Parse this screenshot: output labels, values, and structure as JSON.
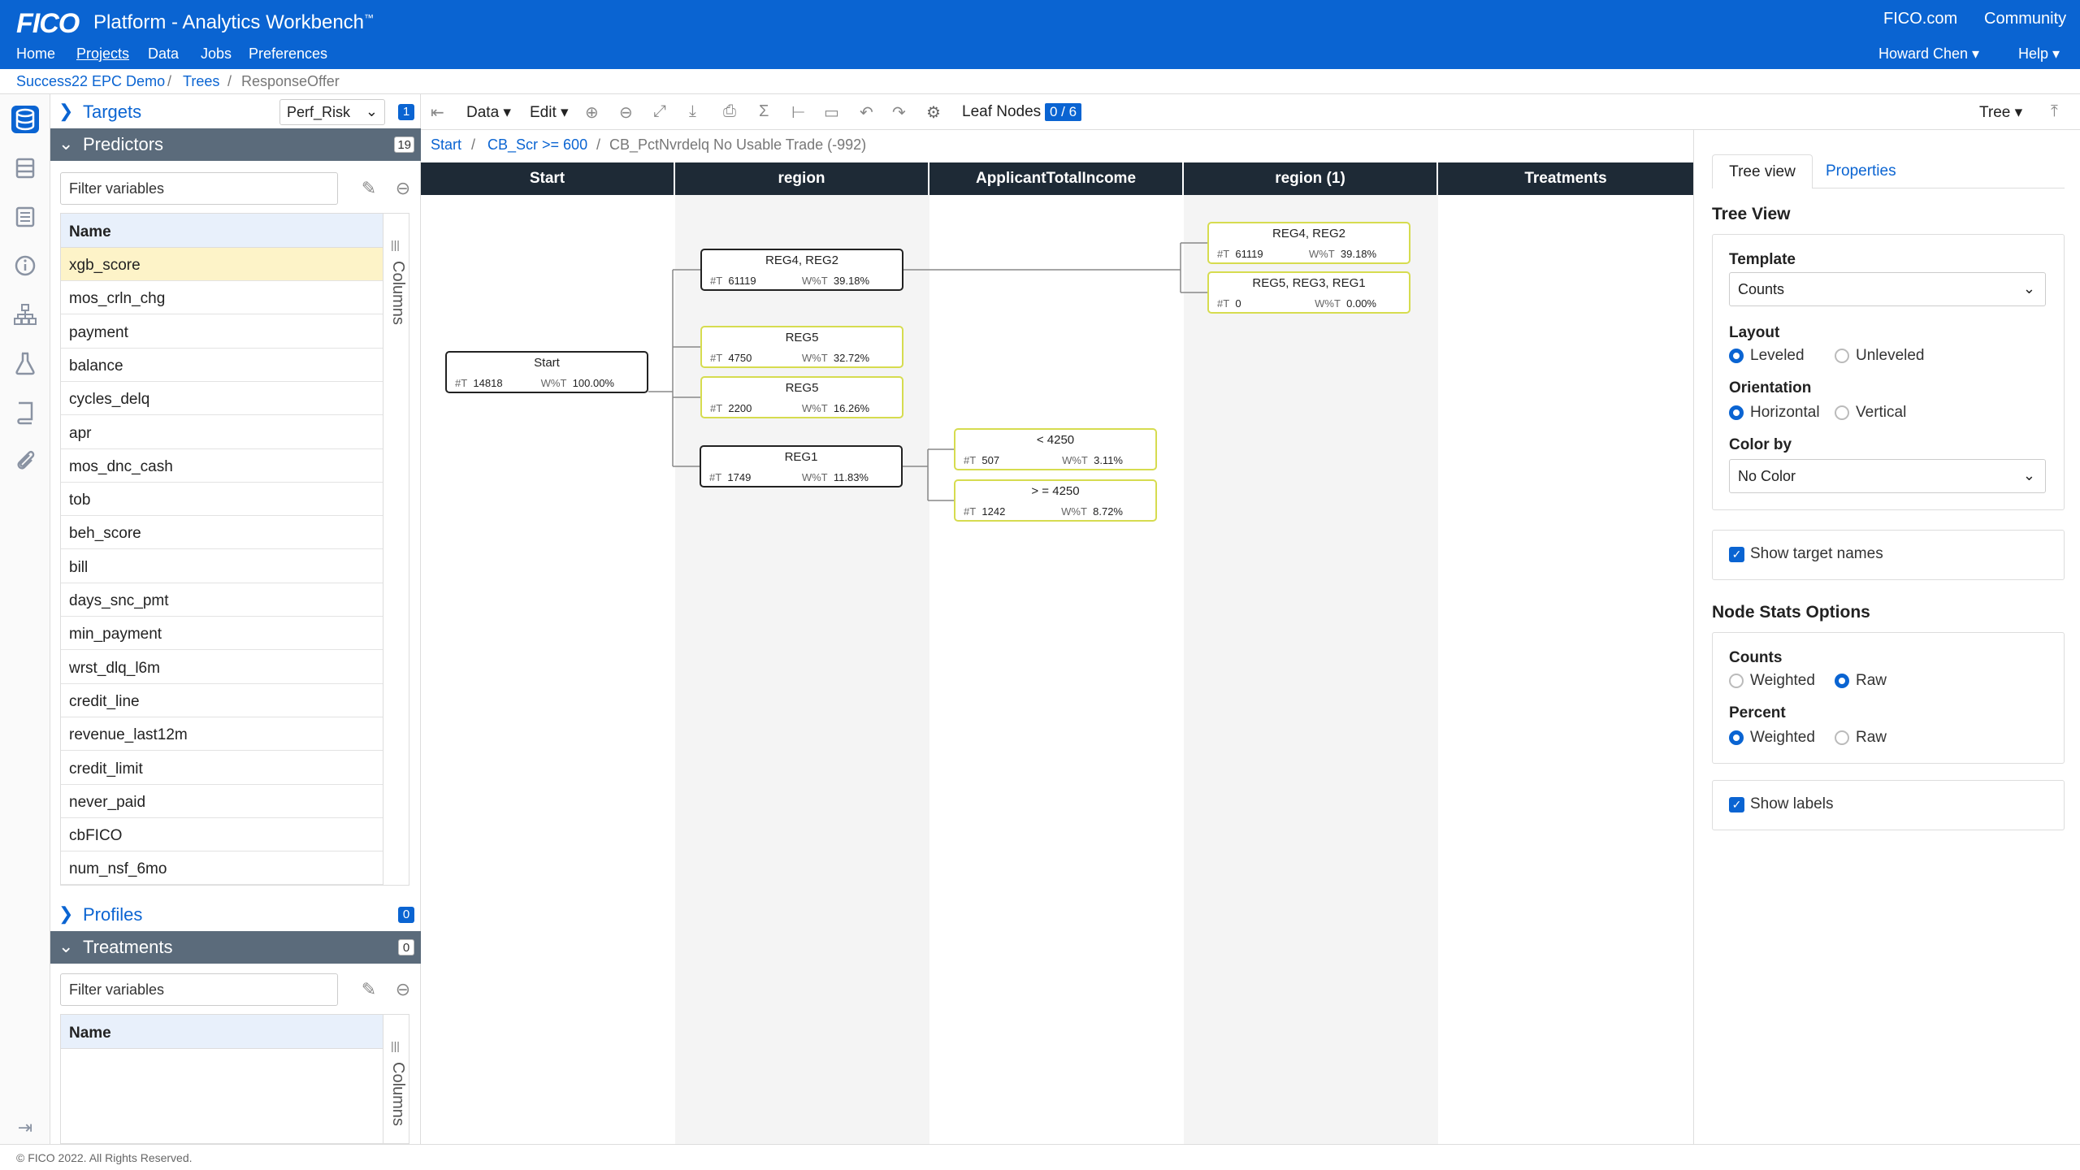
{
  "header": {
    "logo": "FICO",
    "title": "Platform - Analytics Workbench",
    "title_mark": "™",
    "links": {
      "fico": "FICO.com",
      "community": "Community"
    },
    "nav": [
      "Home",
      "Projects",
      "Data",
      "Jobs",
      "Preferences"
    ],
    "user": "Howard Chen ▾",
    "help": "Help ▾"
  },
  "breadcrumb": [
    "Success22 EPC Demo",
    "Trees",
    "ResponseOffer"
  ],
  "left_panel": {
    "targets": {
      "label": "Targets",
      "selected": "Perf_Risk",
      "count": "1"
    },
    "predictors": {
      "label": "Predictors",
      "count": "19",
      "filter_placeholder": "Filter variables",
      "column_header": "Name",
      "columns_label": "Columns",
      "items": [
        "xgb_score",
        "mos_crln_chg",
        "payment",
        "balance",
        "cycles_delq",
        "apr",
        "mos_dnc_cash",
        "tob",
        "beh_score",
        "bill",
        "days_snc_pmt",
        "min_payment",
        "wrst_dlq_l6m",
        "credit_line",
        "revenue_last12m",
        "credit_limit",
        "never_paid",
        "cbFICO",
        "num_nsf_6mo"
      ]
    },
    "profiles": {
      "label": "Profiles",
      "count": "0"
    },
    "treatments": {
      "label": "Treatments",
      "count": "0",
      "filter_placeholder": "Filter variables",
      "column_header": "Name",
      "columns_label": "Columns"
    }
  },
  "toolbar": {
    "data": "Data ▾",
    "edit": "Edit ▾",
    "leaf_nodes_label": "Leaf Nodes",
    "leaf_nodes_value": "0 / 6",
    "view": "Tree ▾"
  },
  "path": {
    "start": "Start",
    "step1": "CB_Scr >= 600",
    "current": "CB_PctNvrdelq No Usable Trade (-992)"
  },
  "tree": {
    "columns": [
      "Start",
      "region",
      "ApplicantTotalIncome",
      "region (1)",
      "Treatments"
    ],
    "stat_t_label": "#T",
    "stat_w_label": "W%T",
    "nodes": {
      "start": {
        "label": "Start",
        "t": "14818",
        "w": "100.00%"
      },
      "reg42": {
        "label": "REG4, REG2",
        "t": "61119",
        "w": "39.18%"
      },
      "reg5a": {
        "label": "REG5",
        "t": "4750",
        "w": "32.72%"
      },
      "reg5b": {
        "label": "REG5",
        "t": "2200",
        "w": "16.26%"
      },
      "reg1": {
        "label": "REG1",
        "t": "1749",
        "w": "11.83%"
      },
      "lt4250": {
        "label": "< 4250",
        "t": "507",
        "w": "3.11%"
      },
      "ge4250": {
        "label": "> = 4250",
        "t": "1242",
        "w": "8.72%"
      },
      "r_reg42": {
        "label": "REG4, REG2",
        "t": "61119",
        "w": "39.18%"
      },
      "r_reg531": {
        "label": "REG5, REG3, REG1",
        "t": "0",
        "w": "0.00%"
      }
    }
  },
  "right_panel": {
    "tabs": [
      "Tree view",
      "Properties"
    ],
    "tree_view_title": "Tree View",
    "template_label": "Template",
    "template_value": "Counts",
    "layout_label": "Layout",
    "layout_options": [
      "Leveled",
      "Unleveled"
    ],
    "orientation_label": "Orientation",
    "orientation_options": [
      "Horizontal",
      "Vertical"
    ],
    "colorby_label": "Color by",
    "colorby_value": "No Color",
    "show_target_names": "Show target names",
    "node_stats_title": "Node Stats Options",
    "counts_label": "Counts",
    "counts_options": [
      "Weighted",
      "Raw"
    ],
    "percent_label": "Percent",
    "percent_options": [
      "Weighted",
      "Raw"
    ],
    "show_labels": "Show labels"
  },
  "footer": "© FICO 2022. All Rights Reserved.",
  "colors": {
    "brand": "#0a64d2",
    "header_dark": "#1e2a36",
    "leaf_border": "#d6dc4f",
    "section_dark": "#5b6b7b"
  }
}
